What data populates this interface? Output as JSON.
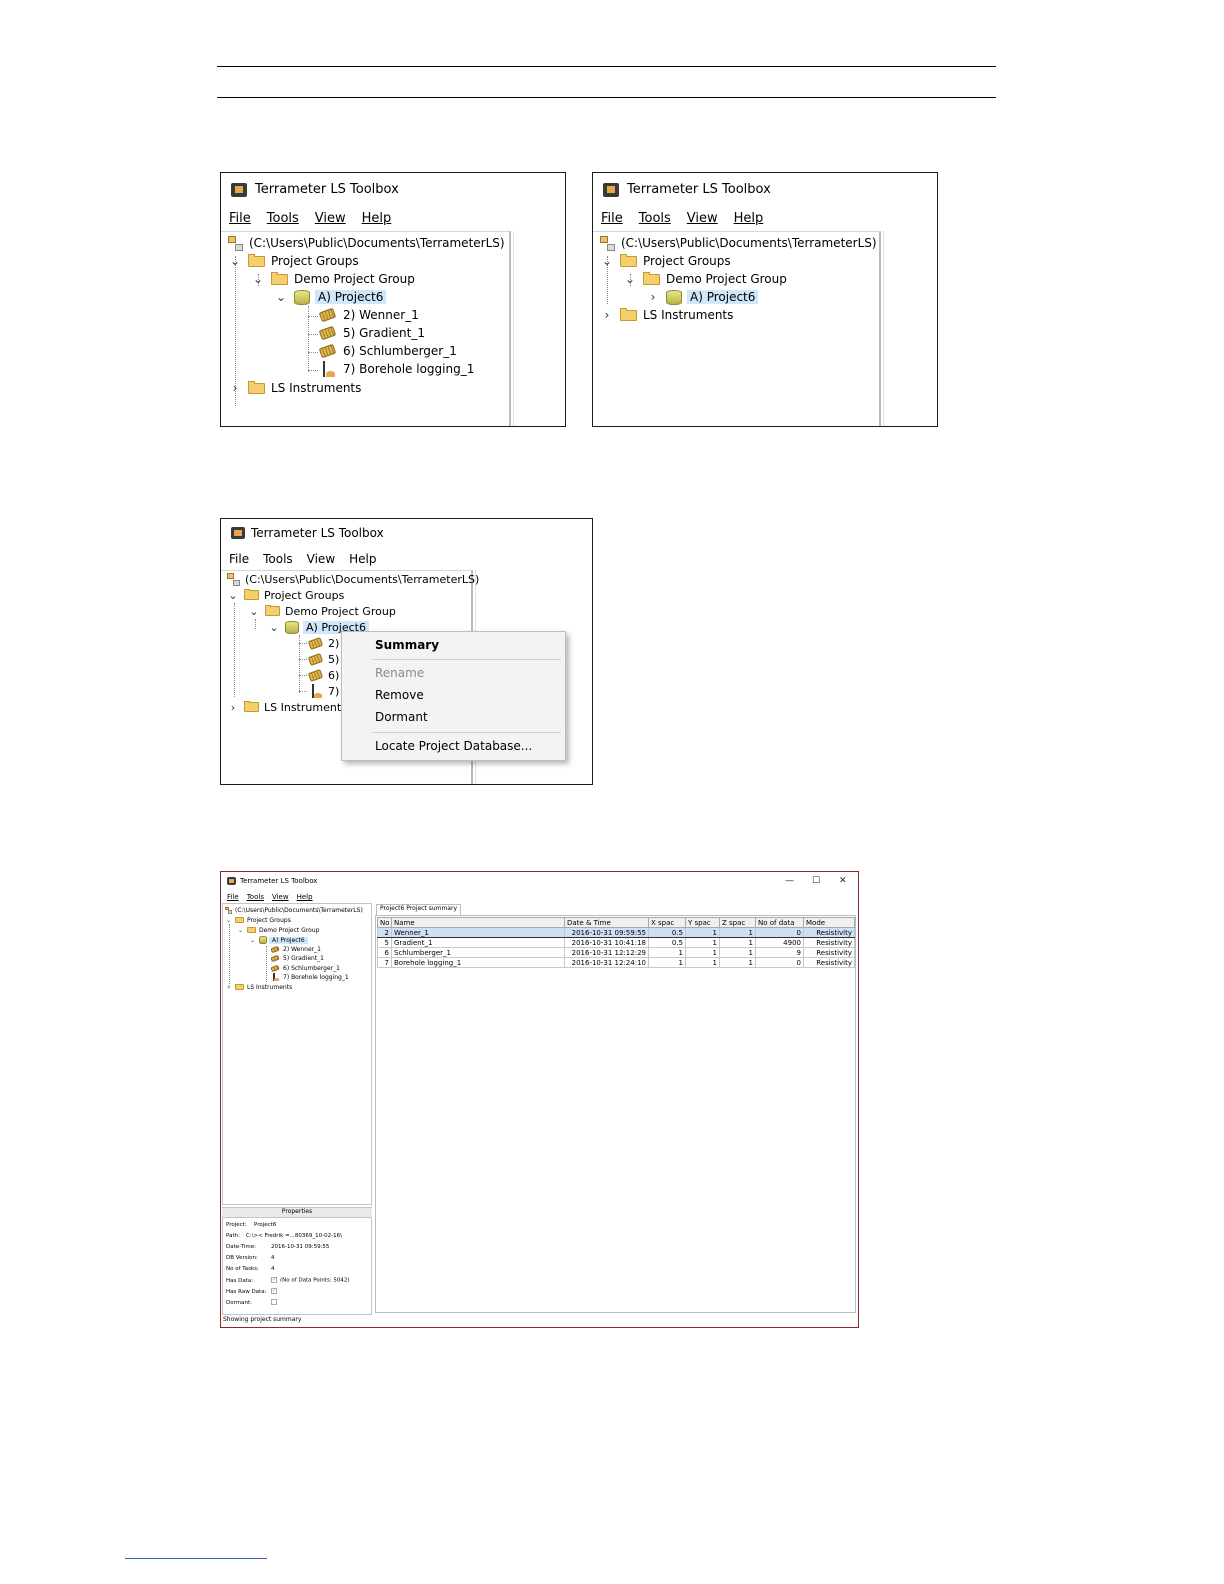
{
  "app_title": "Terrameter LS Toolbox",
  "menu": {
    "file": "File",
    "tools": "Tools",
    "view": "View",
    "help": "Help"
  },
  "tree": {
    "root": "(C:\\Users\\Public\\Documents\\TerrameterLS)",
    "project_groups": "Project Groups",
    "demo_group": "Demo Project Group",
    "project": "A) Project6",
    "tasks": [
      "2) Wenner_1",
      "5) Gradient_1",
      "6) Schlumberger_1",
      "7) Borehole logging_1"
    ],
    "tasks_truncated": [
      "2)",
      "5)",
      "6)",
      "7)"
    ],
    "ls_instruments": "LS Instruments"
  },
  "context_menu": {
    "summary": "Summary",
    "rename": "Rename",
    "remove": "Remove",
    "dormant": "Dormant",
    "locate": "Locate Project Database..."
  },
  "summary_window": {
    "title": "Terrameter LS Toolbox",
    "window_controls": {
      "minimize": "—",
      "maximize": "☐",
      "close": "✕"
    },
    "tab_label": "Project6 Project summary",
    "columns": [
      "No",
      "Name",
      "Date & Time",
      "X spac",
      "Y spac",
      "Z spac",
      "No of data",
      "Mode"
    ],
    "rows": [
      [
        "2",
        "Wenner_1",
        "2016-10-31 09:59:55",
        "0.5",
        "1",
        "1",
        "0",
        "Resistivity"
      ],
      [
        "5",
        "Gradient_1",
        "2016-10-31 10:41:18",
        "0.5",
        "1",
        "1",
        "4900",
        "Resistivity"
      ],
      [
        "6",
        "Schlumberger_1",
        "2016-10-31 12:12:29",
        "1",
        "1",
        "1",
        "9",
        "Resistivity"
      ],
      [
        "7",
        "Borehole logging_1",
        "2016-10-31 12:24:10",
        "1",
        "1",
        "1",
        "0",
        "Resistivity"
      ]
    ],
    "properties_title": "Properties",
    "properties": {
      "project_label": "Project:",
      "project_value": "Project6",
      "path_label": "Path:",
      "path_value": "C:\\>< Fredrik =...80369_10-02-16\\",
      "datetime_label": "Date-Time:",
      "datetime_value": "2016-10-31 09:59:55",
      "db_label": "DB Version:",
      "db_value": "4",
      "tasks_label": "No of Tasks:",
      "tasks_value": "4",
      "hasdata_label": "Has Data:",
      "hasdata_value": "(No of Data Points: 5042)",
      "hasraw_label": "Has Raw Data:",
      "dormant_label": "Dormant:"
    },
    "status_bar": "Showing project summary"
  },
  "colors": {
    "selection": "#cfe6fb",
    "table_selection": "#cfe0f4",
    "folder": "#f5cf6e",
    "window_border": "#8b2a2a"
  }
}
